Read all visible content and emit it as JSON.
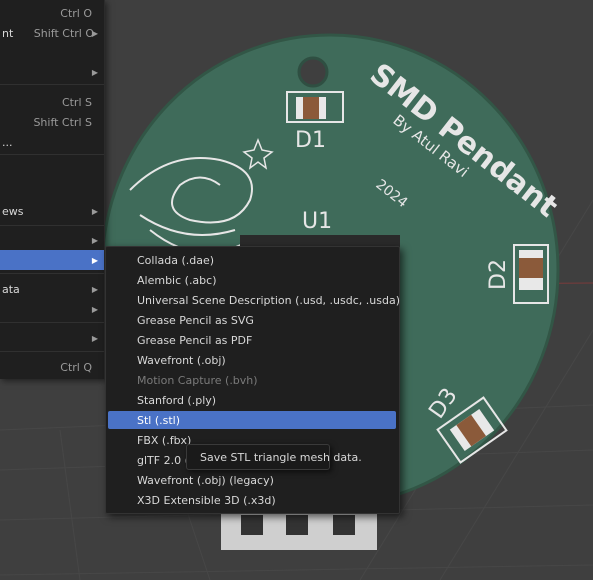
{
  "file_menu": {
    "items": [
      {
        "label": "",
        "shortcut": "Ctrl O"
      },
      {
        "label": "nt",
        "shortcut": "Shift Ctrl O"
      },
      {
        "label": "",
        "shortcut": ""
      },
      {
        "label": "",
        "shortcut": "Ctrl S"
      },
      {
        "label": "",
        "shortcut": "Shift Ctrl S"
      },
      {
        "label": "...",
        "shortcut": ""
      },
      {
        "label": "ews",
        "shortcut": ""
      },
      {
        "label": "",
        "shortcut": ""
      },
      {
        "label": "",
        "shortcut": ""
      },
      {
        "label": "ata",
        "shortcut": ""
      },
      {
        "label": "",
        "shortcut": ""
      },
      {
        "label": "",
        "shortcut": ""
      },
      {
        "label": "",
        "shortcut": "Ctrl Q"
      }
    ]
  },
  "export_menu": {
    "items": [
      {
        "label": "Collada (.dae)",
        "state": "normal"
      },
      {
        "label": "Alembic (.abc)",
        "state": "normal"
      },
      {
        "label": "Universal Scene Description (.usd, .usdc, .usda)",
        "state": "normal"
      },
      {
        "label": "Grease Pencil as SVG",
        "state": "normal"
      },
      {
        "label": "Grease Pencil as PDF",
        "state": "normal"
      },
      {
        "label": "Wavefront (.obj)",
        "state": "normal"
      },
      {
        "label": "Motion Capture (.bvh)",
        "state": "disabled"
      },
      {
        "label": "Stanford (.ply)",
        "state": "normal"
      },
      {
        "label": "Stl (.stl)",
        "state": "active"
      },
      {
        "label": "FBX (.fbx)",
        "state": "normal"
      },
      {
        "label": "glTF 2.0 (",
        "state": "normal"
      },
      {
        "label": "Wavefront (.obj) (legacy)",
        "state": "normal"
      },
      {
        "label": "X3D Extensible 3D (.x3d)",
        "state": "normal"
      }
    ]
  },
  "tooltip": {
    "text": "Save STL triangle mesh data."
  },
  "board": {
    "title": "SMD Pendant",
    "author": "By Atul Ravi",
    "year": "2024",
    "labels": {
      "d1": "D1",
      "d2": "D2",
      "d3": "D3",
      "u1": "U1"
    }
  },
  "colors": {
    "accent": "#4a72c6",
    "menu_background": "#1f1f1f",
    "pcb_green": "#3f6b5a",
    "viewport_background": "#3f3f3f"
  }
}
